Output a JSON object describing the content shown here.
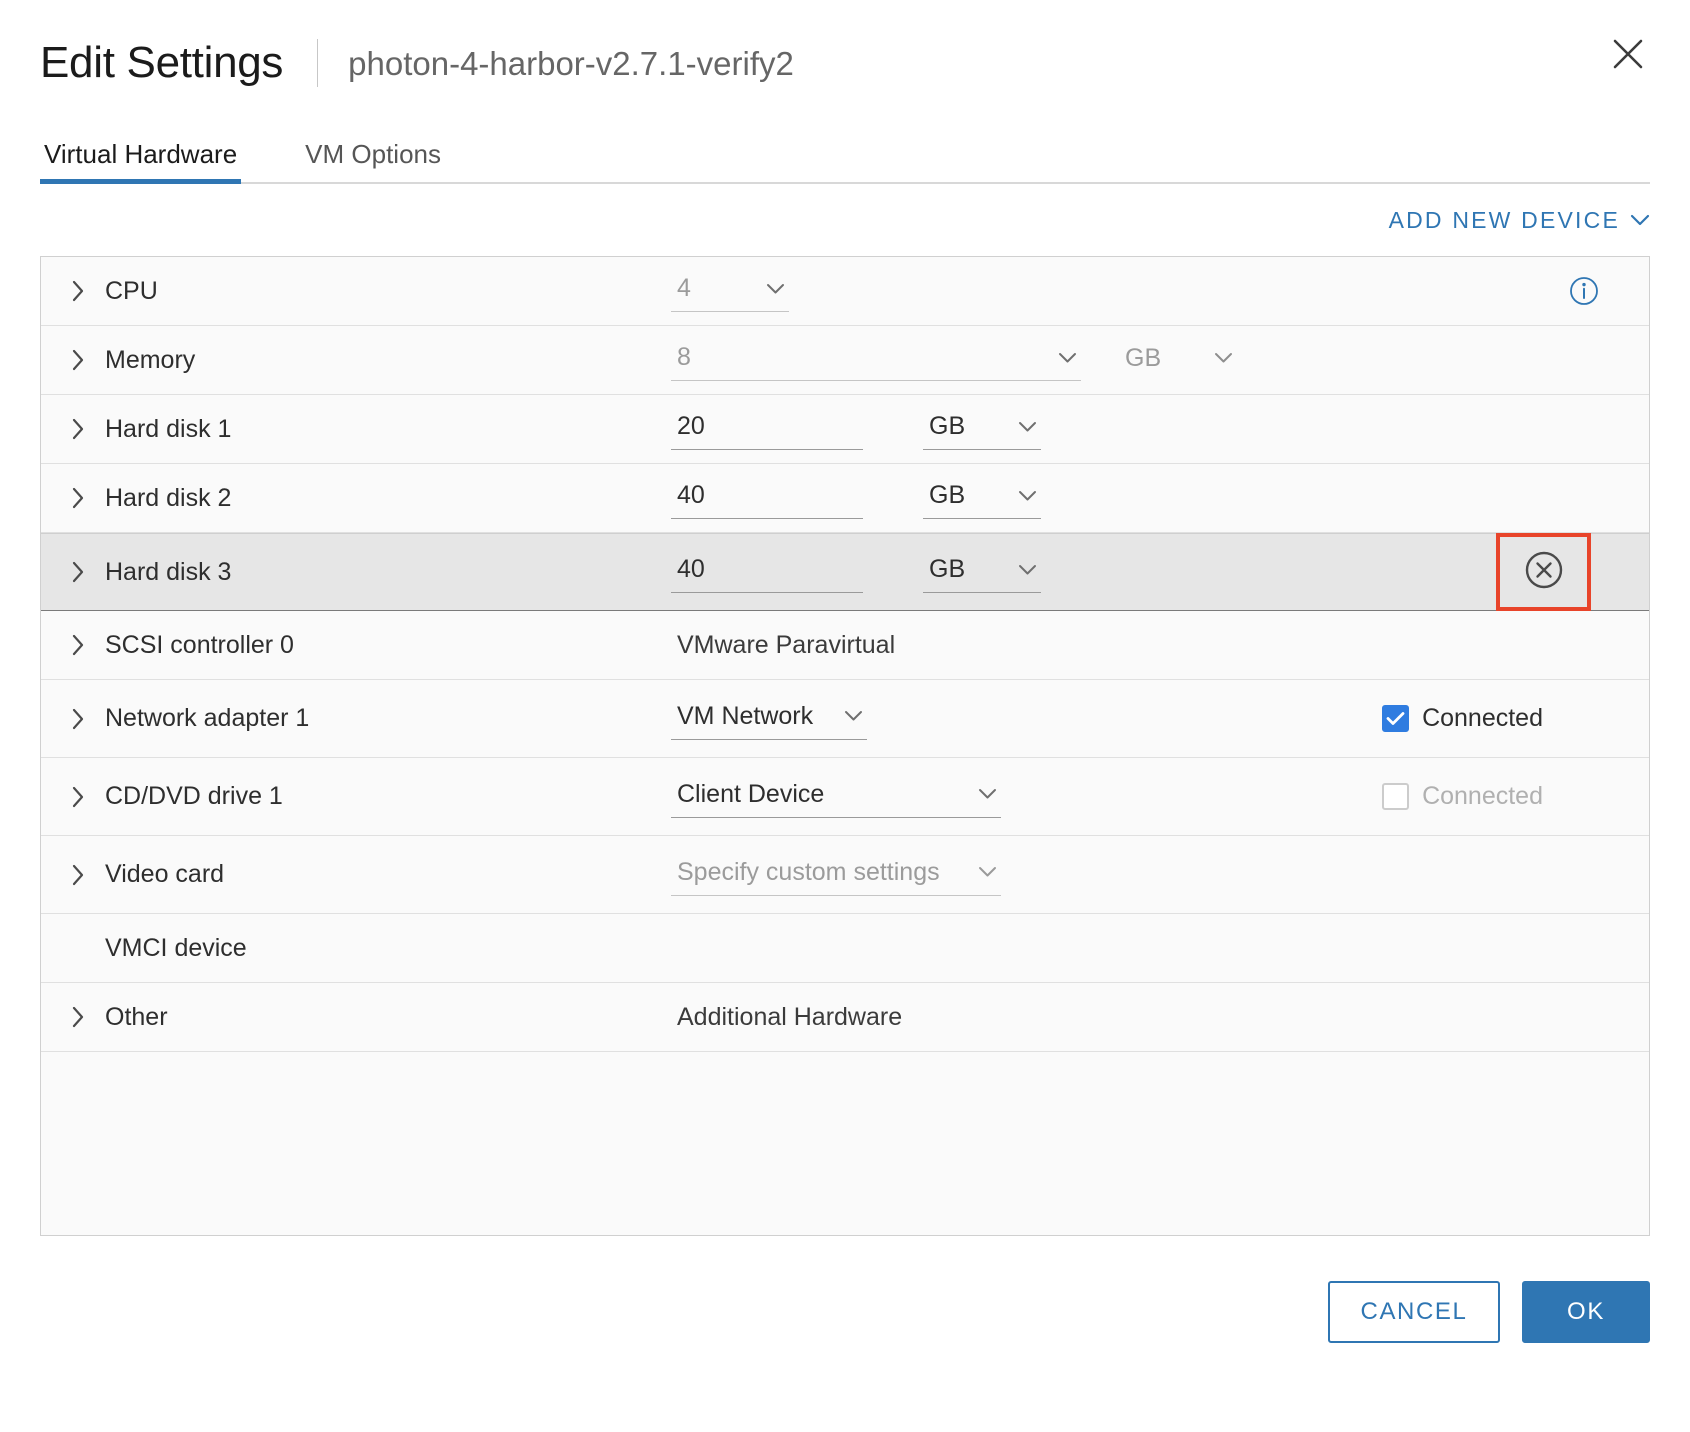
{
  "header": {
    "title": "Edit Settings",
    "vm_name": "photon-4-harbor-v2.7.1-verify2",
    "close_label": "Close"
  },
  "tabs": [
    {
      "label": "Virtual Hardware",
      "active": true
    },
    {
      "label": "VM Options",
      "active": false
    }
  ],
  "toolbar": {
    "add_new_device": "ADD NEW DEVICE"
  },
  "colors": {
    "accent_blue": "#2f76b3",
    "checkbox_blue": "#2f7ce0",
    "highlight_red": "#e8442a",
    "selected_row_bg": "#e6e6e6"
  },
  "devices": [
    {
      "label": "CPU",
      "value": "4",
      "unit": null,
      "type": "select",
      "muted": true,
      "has_info": true,
      "expandable": true
    },
    {
      "label": "Memory",
      "value": "8",
      "unit": "GB",
      "type": "select-with-unit",
      "muted": true,
      "has_info": false,
      "expandable": true
    },
    {
      "label": "Hard disk 1",
      "value": "20",
      "unit": "GB",
      "type": "input-with-unit",
      "muted": false,
      "has_info": false,
      "expandable": true
    },
    {
      "label": "Hard disk 2",
      "value": "40",
      "unit": "GB",
      "type": "input-with-unit",
      "muted": false,
      "has_info": false,
      "expandable": true
    },
    {
      "label": "Hard disk 3",
      "value": "40",
      "unit": "GB",
      "type": "input-with-unit",
      "muted": false,
      "has_info": false,
      "expandable": true,
      "selected": true,
      "removable": true,
      "remove_highlighted": true
    },
    {
      "label": "SCSI controller 0",
      "value": "VMware Paravirtual",
      "type": "static",
      "expandable": true
    },
    {
      "label": "Network adapter 1",
      "value": "VM Network",
      "type": "select",
      "muted": false,
      "expandable": true,
      "connected": {
        "label": "Connected",
        "checked": true,
        "disabled": false
      }
    },
    {
      "label": "CD/DVD drive 1",
      "value": "Client Device",
      "type": "select",
      "muted": false,
      "expandable": true,
      "connected": {
        "label": "Connected",
        "checked": false,
        "disabled": true
      }
    },
    {
      "label": "Video card",
      "value": "Specify custom settings",
      "type": "select",
      "muted": true,
      "expandable": true
    },
    {
      "label": "VMCI device",
      "value": "",
      "type": "static",
      "expandable": false
    },
    {
      "label": "Other",
      "value": "Additional Hardware",
      "type": "static",
      "expandable": true
    }
  ],
  "footer": {
    "cancel_label": "CANCEL",
    "ok_label": "OK"
  }
}
